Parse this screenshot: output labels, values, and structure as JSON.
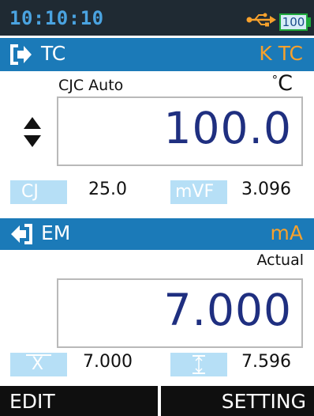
{
  "status_bar": {
    "time": "10:10:10",
    "battery_level": "100",
    "usb_icon": "usb-icon"
  },
  "source": {
    "mode_label": "TC",
    "type_label": "K TC",
    "cjc_mode": "CJC Auto",
    "unit": "C",
    "value": "100.0",
    "arrow_icon": "output-arrow-icon",
    "adjust_icon": "up-down-icon"
  },
  "source_readings": {
    "cj_label": "CJ",
    "cj_value": "25.0",
    "mvf_label": "mVF",
    "mvf_value": "3.096"
  },
  "measure": {
    "mode_label": "EM",
    "unit_label": "mA",
    "status": "Actual",
    "value": "7.000",
    "arrow_icon": "input-arrow-icon"
  },
  "measure_readings": {
    "mean_label": "X",
    "mean_value": "7.000",
    "range_icon": "range-icon",
    "range_value": "7.596"
  },
  "softkeys": {
    "left": "EDIT",
    "right": "SETTING"
  },
  "colors": {
    "status_bg": "#1f2a33",
    "clock": "#4aa3e0",
    "section_bar": "#1b7ab8",
    "accent_orange": "#f7a12c",
    "value_text": "#1f2f80",
    "chip_bg": "#b6dff6",
    "softkey_bg": "#0f0f0f"
  }
}
